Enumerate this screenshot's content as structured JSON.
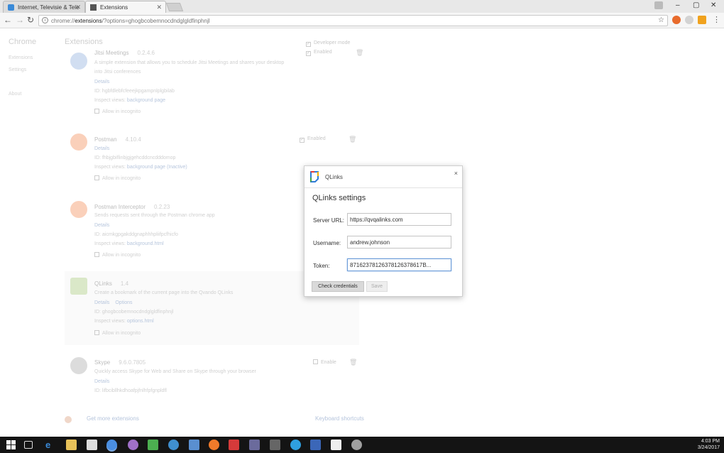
{
  "browser": {
    "tabs": [
      {
        "title": "Internet, Televisie & Tele",
        "active": false
      },
      {
        "title": "Extensions",
        "active": true
      }
    ],
    "url_prefix": "chrome://",
    "url_bold": "extensions",
    "url_suffix": "/?options=ghogbcobemnocdndglgldfinphnjl",
    "window_controls": {
      "minimize": "–",
      "maximize": "▢",
      "close": "✕"
    }
  },
  "sidebar": {
    "title": "Chrome",
    "items": [
      "Extensions",
      "Settings",
      "About"
    ]
  },
  "main": {
    "heading": "Extensions",
    "developer_mode_label": "Developer mode",
    "extensions": [
      {
        "name": "Jitsi Meetings",
        "version": "0.2.4.6",
        "description": "A simple extension that allows you to schedule Jitsi Meetings and shares your desktop",
        "description2": "into Jitsi conferences",
        "details": "Details",
        "id": "ID: hgbfdlebfcfeeejkpgampnlplgbilab",
        "inspect": "Inspect views:",
        "inspect_link": "background page",
        "incognito": "Allow in incognito",
        "status": "Enabled"
      },
      {
        "name": "Postman",
        "version": "4.10.4",
        "details": "Details",
        "id": "ID: fhbjgbiflinbjgjgehcddcncdddomop",
        "inspect": "Inspect views:",
        "inspect_link": "background page (Inactive)",
        "incognito": "Allow in incognito",
        "status": "Enabled"
      },
      {
        "name": "Postman Interceptor",
        "version": "0.2.23",
        "description": "Sends requests sent through the Postman chrome app",
        "details": "Details",
        "id": "ID: aicmkgpgakddgnaphhhpliifpcfhicfo",
        "inspect": "Inspect views:",
        "inspect_link": "background.html",
        "incognito": "Allow in incognito"
      },
      {
        "name": "QLinks",
        "version": "1.4",
        "description": "Create a bookmark of the current page into the Qvando QLinks",
        "details": "Details",
        "options": "Options",
        "id": "ID: ghogbcobemnocdndglgldfinphnjl",
        "inspect": "Inspect views:",
        "inspect_link": "options.html",
        "incognito": "Allow in incognito"
      },
      {
        "name": "Skype",
        "version": "9.6.0.7805",
        "description": "Quickly access Skype for Web and Share on Skype through your browser",
        "details": "Details",
        "id": "ID: lifbcibllhkdhoafpjfnlhfpfgnpldfl",
        "status": "Enable"
      }
    ],
    "get_more": "Get more extensions",
    "keyboard_shortcuts": "Keyboard shortcuts"
  },
  "dialog": {
    "header_title": "QLinks",
    "close": "×",
    "title": "QLinks settings",
    "fields": [
      {
        "label": "Server URL:",
        "value": "https://qvqalinks.com"
      },
      {
        "label": "Username:",
        "value": "andrew.johnson"
      },
      {
        "label": "Token:",
        "value": "87162378126378126378617B..."
      }
    ],
    "check_button": "Check credentials",
    "save_button": "Save"
  },
  "taskbar": {
    "time": "4:03 PM",
    "date": "3/24/2017"
  }
}
